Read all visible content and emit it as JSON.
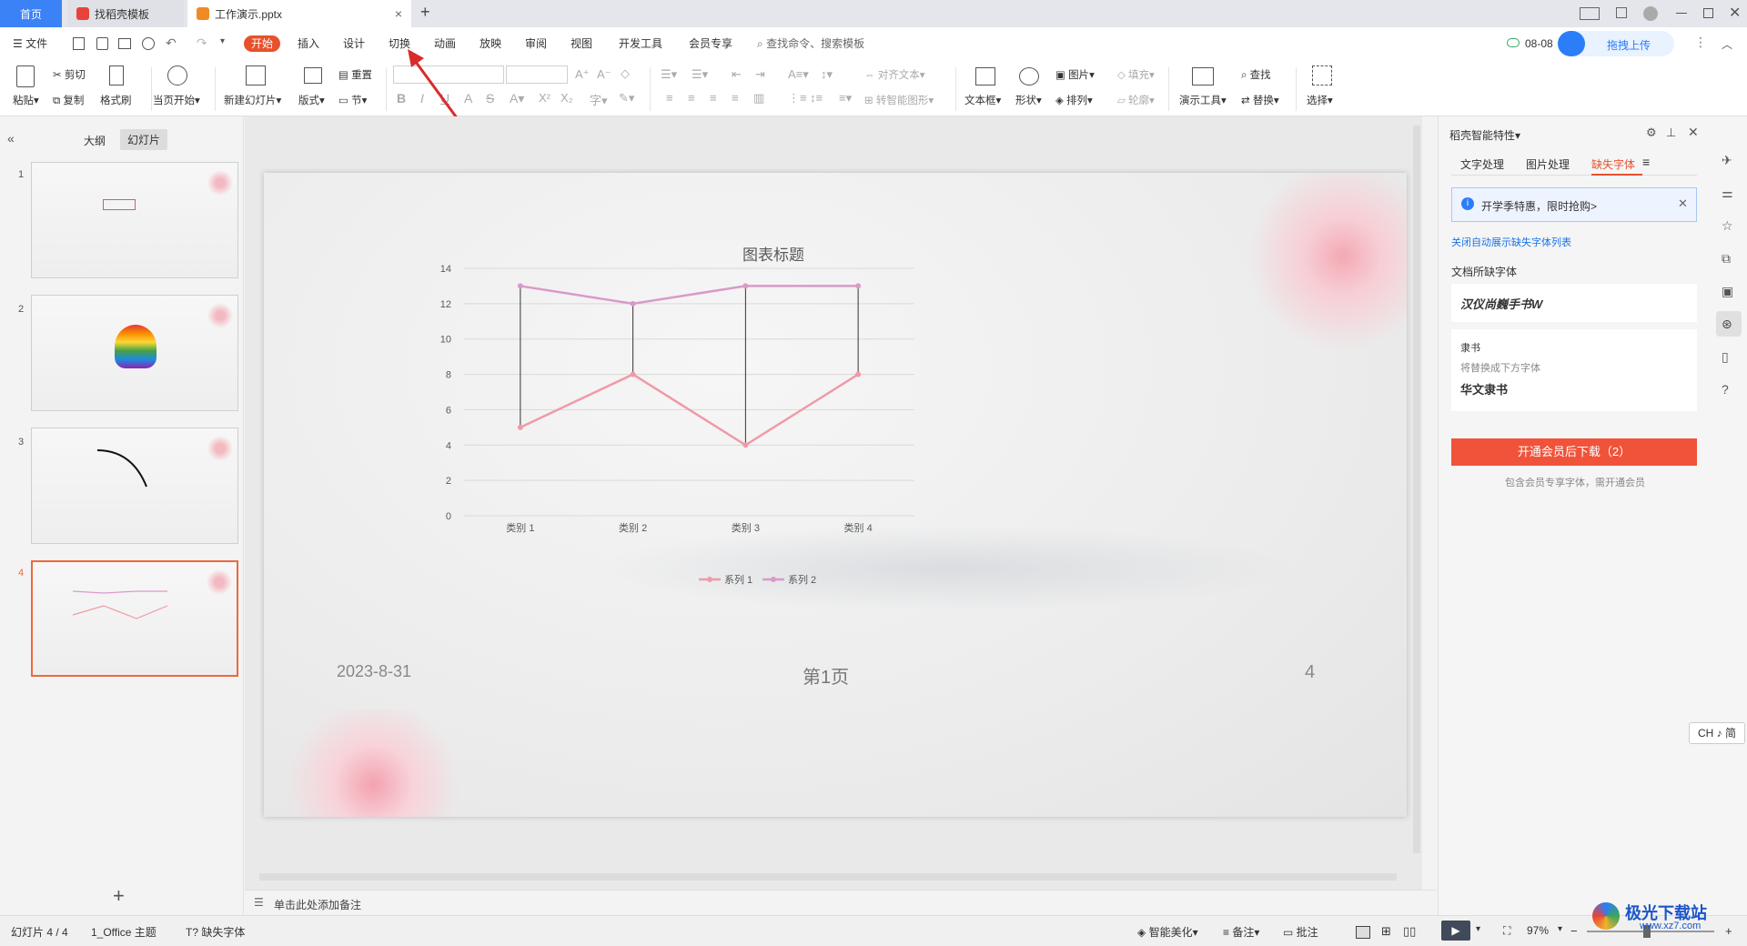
{
  "tabs": {
    "home": "首页",
    "template": "找稻壳模板",
    "doc": "工作演示.pptx",
    "close": "×",
    "add": "+"
  },
  "menu": {
    "file": "文件",
    "items": [
      "开始",
      "插入",
      "设计",
      "切换",
      "动画",
      "放映",
      "审阅",
      "视图",
      "开发工具",
      "会员专享"
    ],
    "search": "查找命令、搜索模板",
    "sync": "08-08",
    "upload": "拖拽上传"
  },
  "ribbon": {
    "paste": "粘贴",
    "cut": "剪切",
    "copy": "复制",
    "format_painter": "格式刷",
    "play_from_current": "当页开始",
    "new_slide": "新建幻灯片",
    "layout": "版式",
    "reset": "重置",
    "section": "节",
    "align_text": "对齐文本",
    "to_smartart": "转智能图形",
    "fill": "填充",
    "outline": "轮廓",
    "textbox": "文本框",
    "shape": "形状",
    "picture": "图片",
    "arrange": "排列",
    "present_tool": "演示工具",
    "find": "查找",
    "replace": "替换",
    "select": "选择"
  },
  "left_panel": {
    "outline_tab": "大纲",
    "slides_tab": "幻灯片",
    "slide_numbers": [
      "1",
      "2",
      "3",
      "4"
    ],
    "add": "+"
  },
  "slide": {
    "date": "2023-8-31",
    "footer": "第1页",
    "number": "4"
  },
  "chart_data": {
    "type": "line",
    "title": "图表标题",
    "categories": [
      "类别 1",
      "类别 2",
      "类别 3",
      "类别 4"
    ],
    "series": [
      {
        "name": "系列 1",
        "values": [
          5,
          8,
          4,
          8
        ],
        "color": "#f09aa7"
      },
      {
        "name": "系列 2",
        "values": [
          13,
          12,
          13,
          13
        ],
        "color": "#d99ac8"
      }
    ],
    "ylim": [
      0,
      14
    ],
    "yticks": [
      0,
      2,
      4,
      6,
      8,
      10,
      12,
      14
    ],
    "high_low_lines": true,
    "legend": "bottom",
    "grid": true
  },
  "notes_placeholder": "单击此处添加备注",
  "right_panel": {
    "title": "稻壳智能特性",
    "tabs": [
      "文字处理",
      "图片处理",
      "缺失字体"
    ],
    "promo": "开学季特惠，限时抢购>",
    "close_list_link": "关闭自动展示缺失字体列表",
    "missing_heading": "文档所缺字体",
    "font1_sample": "汉仪尚巍手书W",
    "font2_name": "隶书",
    "font2_note": "将替换成下方字体",
    "font2_replacement": "华文隶书",
    "download_button": "开通会员后下载（2）",
    "download_note": "包含会员专享字体，需开通会员"
  },
  "ime": "CH ♪ 简",
  "status": {
    "slide_count": "幻灯片 4 / 4",
    "theme": "1_Office 主题",
    "missing_fonts": "缺失字体",
    "beautify": "智能美化",
    "notes": "备注",
    "comments": "批注",
    "zoom": "97%"
  },
  "watermark": {
    "name": "极光下载站",
    "url": "www.xz7.com"
  },
  "colors": {
    "accent": "#e8512b",
    "home_tab": "#3b82f6",
    "download": "#f0533a",
    "link": "#1a73e8"
  }
}
